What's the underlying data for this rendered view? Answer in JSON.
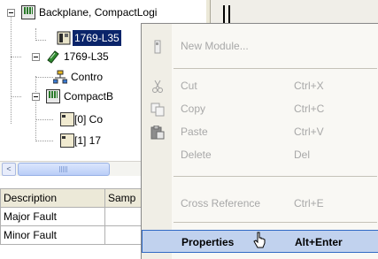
{
  "tree": {
    "items": [
      {
        "label": "Backplane, CompactLogi",
        "icon": "rack-icon"
      },
      {
        "label": "1769-L35",
        "icon": "controller-icon",
        "selected": true
      },
      {
        "label": "1769-L35",
        "icon": "ethernet-module-icon"
      },
      {
        "label": "Contro",
        "icon": "network-icon"
      },
      {
        "label": "CompactB",
        "icon": "rack-icon"
      },
      {
        "label": "[0] Co",
        "icon": "module-card-icon"
      },
      {
        "label": "[1] 17",
        "icon": "module-card-icon"
      }
    ]
  },
  "scrollbar": {
    "left_arrow": "<",
    "grip": "grip-icon"
  },
  "grid": {
    "headers": [
      "Description",
      "Samp"
    ],
    "rows": [
      [
        "Major Fault",
        ""
      ],
      [
        "Minor Fault",
        ""
      ]
    ]
  },
  "context_menu": {
    "items": [
      {
        "label": "New Module...",
        "shortcut": "",
        "disabled": true,
        "icon": "module-card-icon"
      },
      {
        "label": "Cut",
        "shortcut": "Ctrl+X",
        "disabled": true,
        "icon": "scissors-icon"
      },
      {
        "label": "Copy",
        "shortcut": "Ctrl+C",
        "disabled": true,
        "icon": "copy-icon"
      },
      {
        "label": "Paste",
        "shortcut": "Ctrl+V",
        "disabled": true,
        "icon": "paste-icon"
      },
      {
        "label": "Delete",
        "shortcut": "Del",
        "disabled": true,
        "icon": ""
      },
      {
        "label": "Cross Reference",
        "shortcut": "Ctrl+E",
        "disabled": true,
        "icon": ""
      },
      {
        "label": "Properties",
        "shortcut": "Alt+Enter",
        "disabled": false,
        "highlighted": true,
        "icon": ""
      }
    ]
  },
  "colors": {
    "selection": "#0a246a",
    "menu_highlight": "#c1d2ee",
    "menu_highlight_border": "#316ac5",
    "disabled_text": "#a8a8a8"
  }
}
